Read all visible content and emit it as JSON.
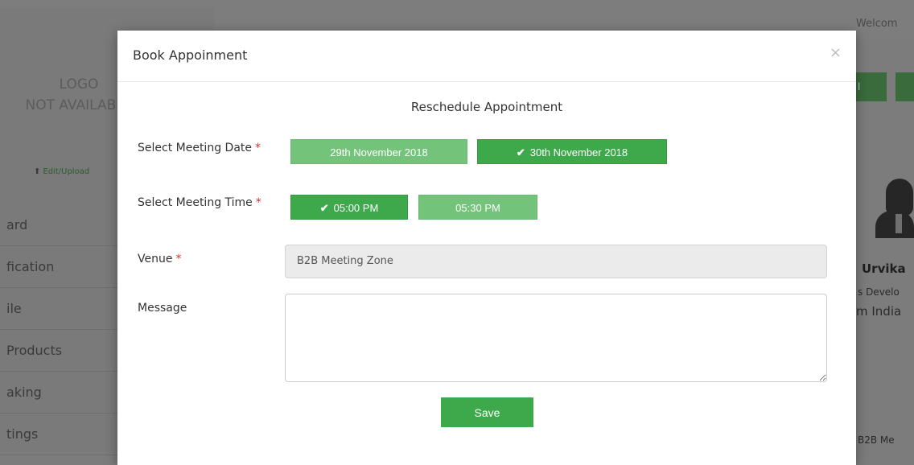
{
  "background": {
    "welcome_text": "Welcom",
    "logo_placeholder_line1": "LOGO",
    "logo_placeholder_line2": "NOT AVAILABLE",
    "edit_upload_link": "Edit/Upload",
    "sidebar_items": [
      "ard",
      "fication",
      "ile",
      "Products",
      "aking",
      "tings"
    ],
    "top_button_text": "l",
    "profile": {
      "name": "Urvika",
      "role": "s Develo",
      "company": "m India"
    },
    "bottom_text": "B2B Me"
  },
  "modal": {
    "title": "Book Appoinment",
    "close_icon": "×",
    "subtitle": "Reschedule Appointment",
    "date_label": "Select Meeting Date",
    "time_label": "Select Meeting Time",
    "venue_label": "Venue",
    "message_label": "Message",
    "required_marker": "*",
    "dates": [
      {
        "label": "29th November 2018",
        "selected": false
      },
      {
        "label": "30th November 2018",
        "selected": true
      }
    ],
    "times": [
      {
        "label": "05:00 PM",
        "selected": true
      },
      {
        "label": "05:30 PM",
        "selected": false
      }
    ],
    "check_icon": "✔",
    "venue_value": "B2B Meeting Zone",
    "message_value": "",
    "save_label": "Save"
  },
  "colors": {
    "accent_green": "#3da94a",
    "light_green": "#73c47a",
    "required_red": "#d9302c"
  }
}
